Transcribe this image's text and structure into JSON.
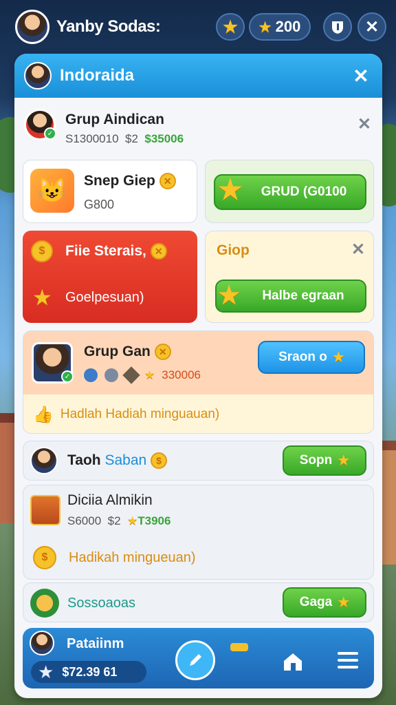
{
  "topbar": {
    "player_name": "Yanby Sodas:",
    "coins": "200",
    "close_symbol": "✕"
  },
  "panel": {
    "title": "Indoraida",
    "close_symbol": "✕"
  },
  "group_header": {
    "title": "Grup Aindican",
    "stat_a": "S1300010",
    "stat_b": "$2",
    "stat_c": "$35006"
  },
  "card_snep": {
    "title": "Snep Giep",
    "subtitle": "G800"
  },
  "card_grud": {
    "button_label": "GRUD (G0100"
  },
  "card_red": {
    "title": "Fiie Sterais,",
    "subtitle": "Goelpesuan)"
  },
  "card_giop": {
    "title": "Giop",
    "button_label": "Halbe egraan"
  },
  "grup_gan": {
    "title": "Grup Gan",
    "stat": "330006",
    "button_label": "Sraon o",
    "reward_label": "Hadlah Hadiah minguauan)"
  },
  "tanh_row": {
    "title_a": "Taoh",
    "title_b": "Saban",
    "button_label": "Sopn"
  },
  "dicia_row": {
    "title": "Diciia Almikin",
    "stat_a": "S6000",
    "stat_b": "$2",
    "stat_c": "T3906",
    "reward_label": "Hadikah mingueuan)"
  },
  "sosso_row": {
    "title": "Sossoaoas",
    "button_label": "Gaga"
  },
  "bottom": {
    "partial_title": "Pataiinm",
    "balance": "$72.39 61"
  },
  "colors": {
    "header_blue": "#1a8fd8",
    "green_button": "#38a828",
    "red_card": "#e5352a",
    "peach_card": "#ffd7b8",
    "cream_card": "#fff6da"
  },
  "icons": [
    "star-icon",
    "coin-icon",
    "gift-icon",
    "pencil-icon",
    "house-icon",
    "menu-icon",
    "close-icon",
    "shield-icon",
    "thumbs-up-icon"
  ]
}
